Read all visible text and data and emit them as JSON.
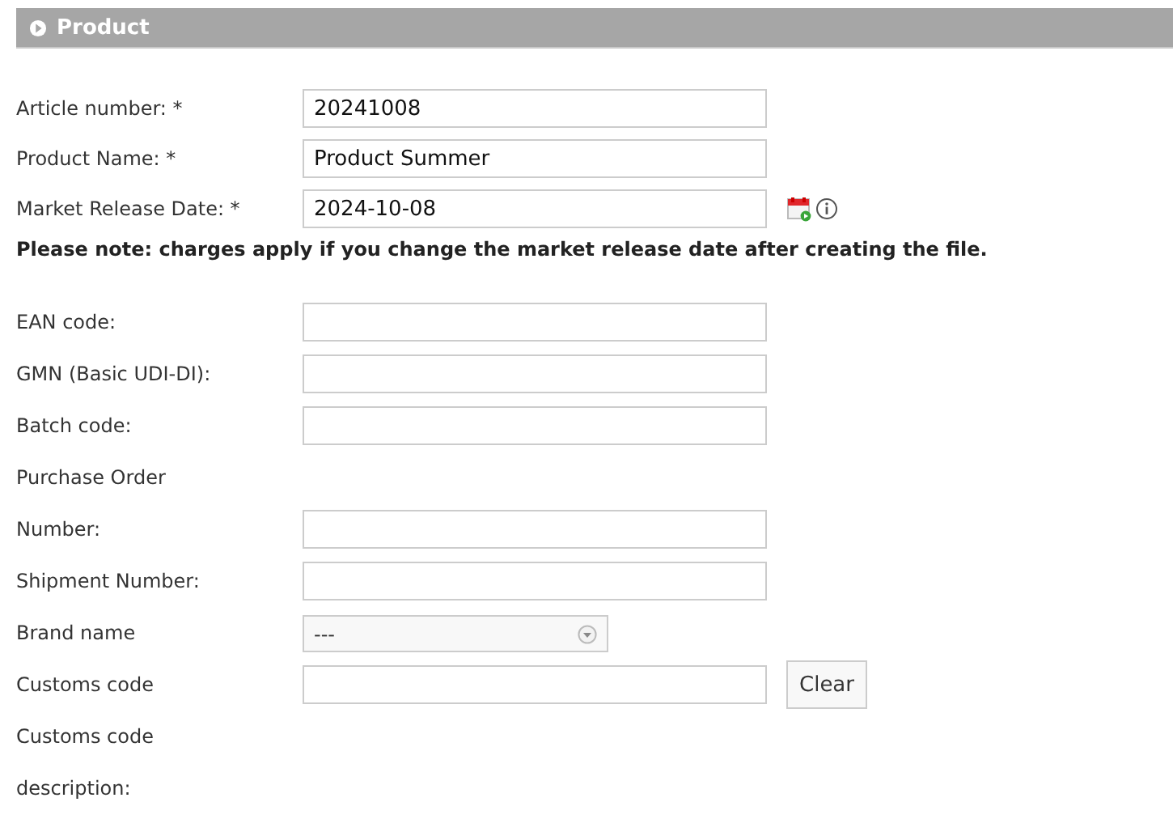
{
  "section": {
    "title": "Product"
  },
  "top_fields": [
    {
      "kind": "text",
      "label": "Article number: *",
      "value": "20241008"
    },
    {
      "kind": "text",
      "label": "Product Name: *",
      "value": "Product Summer"
    },
    {
      "kind": "date",
      "label": "Market Release Date: *",
      "value": "2024-10-08"
    }
  ],
  "note": "Please note: charges apply if you change the market release date after creating the file.",
  "fields": [
    {
      "kind": "text",
      "label_lines": [
        "EAN code:"
      ]
    },
    {
      "kind": "text",
      "label_lines": [
        "GMN (Basic UDI-DI):"
      ]
    },
    {
      "kind": "text",
      "label_lines": [
        "Batch code:"
      ]
    },
    {
      "kind": "text",
      "label_lines": [
        "Purchase Order",
        "Number:"
      ]
    },
    {
      "kind": "text",
      "label_lines": [
        "Shipment Number:"
      ]
    },
    {
      "kind": "select",
      "label_lines": [
        "Brand name"
      ],
      "value": "---"
    },
    {
      "kind": "clearable",
      "label_lines": [
        "Customs code"
      ],
      "button": "Clear"
    },
    {
      "kind": "label",
      "label_lines": [
        "Customs code",
        "description:"
      ]
    }
  ]
}
